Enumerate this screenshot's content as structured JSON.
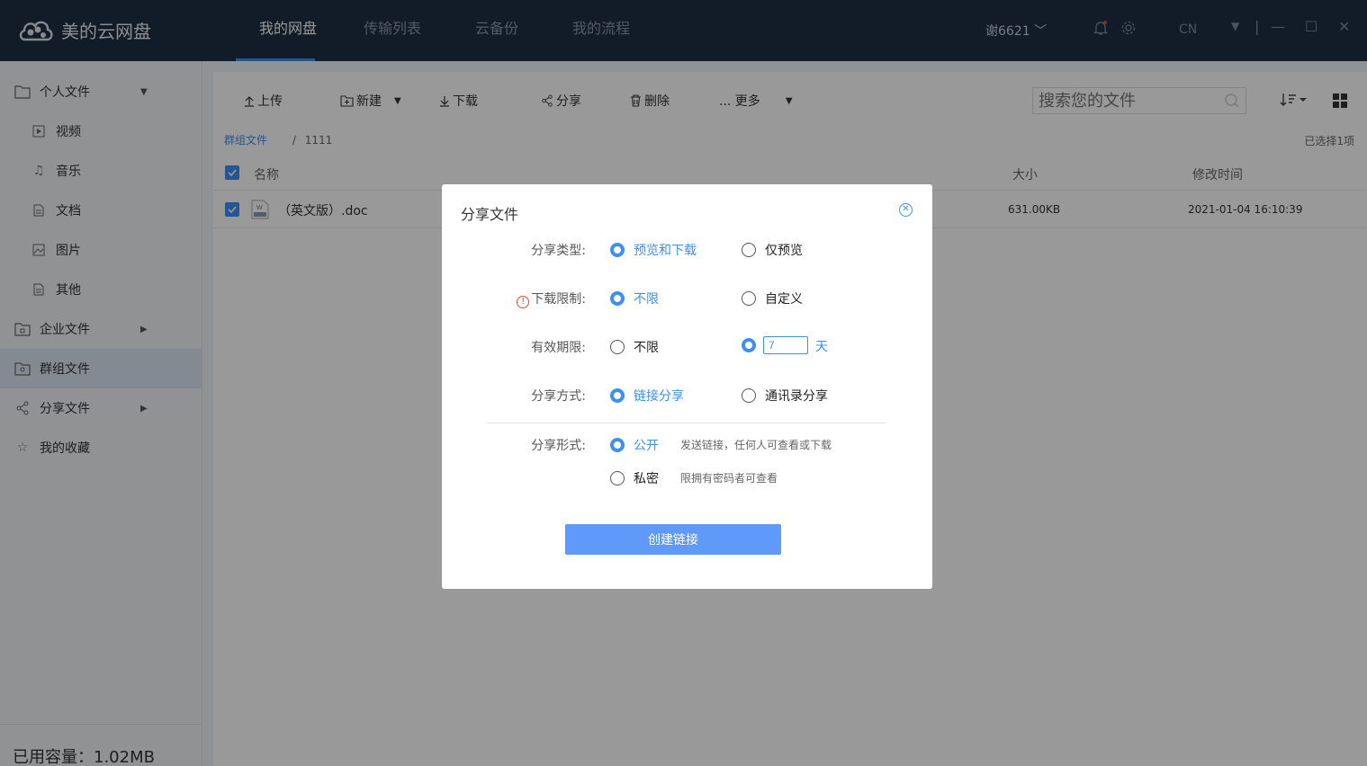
{
  "app": {
    "title": "美的云网盘",
    "nav": [
      "我的网盘",
      "传输列表",
      "云备份",
      "我的流程"
    ],
    "user": "谢6621 ﹀",
    "lang": "CN"
  },
  "sidebar": {
    "personal": "个人文件",
    "sub": [
      "视频",
      "音乐",
      "文档",
      "图片",
      "其他"
    ],
    "enterprise": "企业文件",
    "group": "群组文件",
    "share": "分享文件",
    "favorites": "我的收藏",
    "storage": "已用容量：1.02MB"
  },
  "toolbar": {
    "upload": "上传",
    "new": "新建",
    "download": "下载",
    "share": "分享",
    "delete": "删除",
    "more": "... 更多",
    "search_placeholder": "搜索您的文件"
  },
  "breadcrumb": {
    "root": "群组文件",
    "current": "1111"
  },
  "selected_count": "已选择1项",
  "table": {
    "headers": {
      "name": "名称",
      "size": "大小",
      "modified": "修改时间"
    },
    "rows": [
      {
        "name": "（英文版）.doc",
        "size": "631.00KB",
        "modified": "2021-01-04 16:10:39"
      }
    ]
  },
  "dialog": {
    "title": "分享文件",
    "share_type": {
      "label": "分享类型:",
      "options": [
        "预览和下载",
        "仅预览"
      ],
      "selected": 0
    },
    "download_limit": {
      "label": "下载限制:",
      "options": [
        "不限",
        "自定义"
      ],
      "selected": 0
    },
    "validity": {
      "label": "有效期限:",
      "options": [
        "不限"
      ],
      "custom_value": "7",
      "unit": "天",
      "selected": 1
    },
    "share_method": {
      "label": "分享方式:",
      "options": [
        "链接分享",
        "通讯录分享"
      ],
      "selected": 0
    },
    "share_form": {
      "label": "分享形式:",
      "options": [
        "公开",
        "私密"
      ],
      "hints": [
        "发送链接，任何人可查看或下载",
        "限拥有密码者可查看"
      ],
      "selected": 0
    },
    "create_button": "创建链接"
  }
}
